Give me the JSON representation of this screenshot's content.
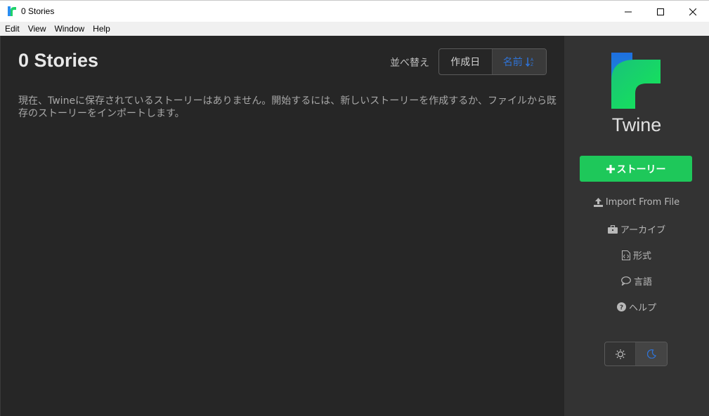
{
  "window": {
    "title": "0 Stories",
    "controls": [
      "minimize-icon",
      "maximize-icon",
      "close-icon"
    ]
  },
  "menu": {
    "items": [
      "Edit",
      "View",
      "Window",
      "Help"
    ]
  },
  "main": {
    "title": "0 Stories",
    "sort": {
      "label": "並べ替え",
      "options": [
        "作成日",
        "名前"
      ],
      "selected": "名前",
      "selected_icon": "sort-alpha-icon"
    },
    "empty_message": "現在、Twineに保存されているストーリーはありません。開始するには、新しいストーリーを作成するか、ファイルから既存のストーリーをインポートします。"
  },
  "sidebar": {
    "brand": "Twine",
    "new_story_label": "ストーリー",
    "links": {
      "import": "Import From File",
      "archive": "アーカイブ",
      "format": "形式",
      "language": "言語",
      "help": "ヘルプ"
    },
    "theme": {
      "options": [
        "sun-icon",
        "moon-icon"
      ],
      "selected": "moon-icon"
    }
  },
  "colors": {
    "main_bg": "#262626",
    "sidebar_bg": "#333333",
    "accent_green": "#1ec85a",
    "accent_blue": "#2f73d6"
  }
}
